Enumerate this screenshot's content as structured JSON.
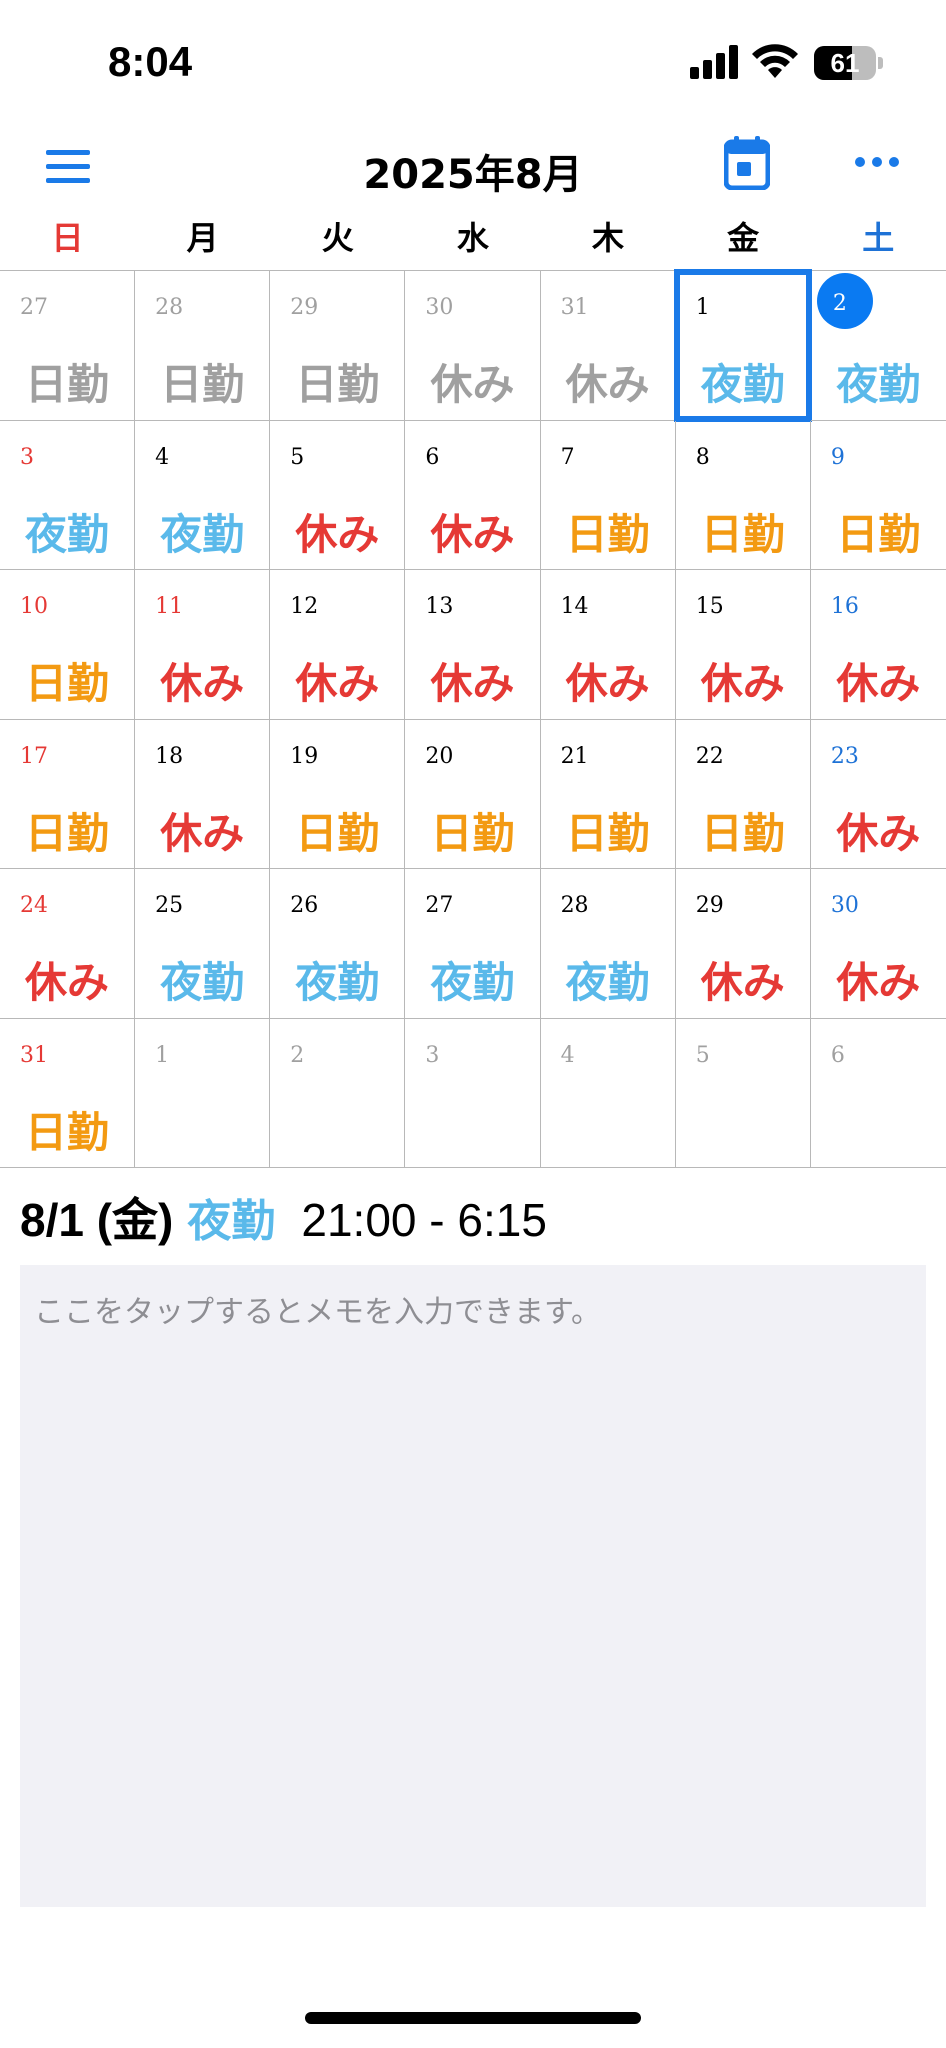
{
  "status_bar": {
    "time": "8:04",
    "battery": "61",
    "battery_level": 0.61
  },
  "header": {
    "title": "2025年8月"
  },
  "weekdays": [
    "日",
    "月",
    "火",
    "水",
    "木",
    "金",
    "土"
  ],
  "colors": {
    "sunday": "#e53935",
    "saturday": "#1e72d6",
    "weekday": "#000000",
    "outside": "#a0a0a0",
    "day_shift": "#f39a12",
    "night_shift": "#5ab9ea",
    "off": "#e53935",
    "accent": "#1a7ae8"
  },
  "calendar": {
    "weeks": [
      [
        {
          "day": "27",
          "shift": "日勤",
          "outside": true
        },
        {
          "day": "28",
          "shift": "日勤",
          "outside": true
        },
        {
          "day": "29",
          "shift": "日勤",
          "outside": true
        },
        {
          "day": "30",
          "shift": "休み",
          "outside": true
        },
        {
          "day": "31",
          "shift": "休み",
          "outside": true
        },
        {
          "day": "1",
          "shift": "夜勤",
          "type": "night",
          "selected": true
        },
        {
          "day": "2",
          "shift": "夜勤",
          "type": "night",
          "today": true
        }
      ],
      [
        {
          "day": "3",
          "shift": "夜勤",
          "type": "night"
        },
        {
          "day": "4",
          "shift": "夜勤",
          "type": "night"
        },
        {
          "day": "5",
          "shift": "休み",
          "type": "off"
        },
        {
          "day": "6",
          "shift": "休み",
          "type": "off"
        },
        {
          "day": "7",
          "shift": "日勤",
          "type": "day"
        },
        {
          "day": "8",
          "shift": "日勤",
          "type": "day"
        },
        {
          "day": "9",
          "shift": "日勤",
          "type": "day"
        }
      ],
      [
        {
          "day": "10",
          "shift": "日勤",
          "type": "day"
        },
        {
          "day": "11",
          "shift": "休み",
          "type": "off",
          "holiday": true
        },
        {
          "day": "12",
          "shift": "休み",
          "type": "off"
        },
        {
          "day": "13",
          "shift": "休み",
          "type": "off"
        },
        {
          "day": "14",
          "shift": "休み",
          "type": "off"
        },
        {
          "day": "15",
          "shift": "休み",
          "type": "off"
        },
        {
          "day": "16",
          "shift": "休み",
          "type": "off"
        }
      ],
      [
        {
          "day": "17",
          "shift": "日勤",
          "type": "day"
        },
        {
          "day": "18",
          "shift": "休み",
          "type": "off"
        },
        {
          "day": "19",
          "shift": "日勤",
          "type": "day"
        },
        {
          "day": "20",
          "shift": "日勤",
          "type": "day"
        },
        {
          "day": "21",
          "shift": "日勤",
          "type": "day"
        },
        {
          "day": "22",
          "shift": "日勤",
          "type": "day"
        },
        {
          "day": "23",
          "shift": "休み",
          "type": "off"
        }
      ],
      [
        {
          "day": "24",
          "shift": "休み",
          "type": "off"
        },
        {
          "day": "25",
          "shift": "夜勤",
          "type": "night"
        },
        {
          "day": "26",
          "shift": "夜勤",
          "type": "night"
        },
        {
          "day": "27",
          "shift": "夜勤",
          "type": "night"
        },
        {
          "day": "28",
          "shift": "夜勤",
          "type": "night"
        },
        {
          "day": "29",
          "shift": "休み",
          "type": "off"
        },
        {
          "day": "30",
          "shift": "休み",
          "type": "off"
        }
      ],
      [
        {
          "day": "31",
          "shift": "日勤",
          "type": "day"
        },
        {
          "day": "1",
          "shift": "",
          "outside": true
        },
        {
          "day": "2",
          "shift": "",
          "outside": true
        },
        {
          "day": "3",
          "shift": "",
          "outside": true
        },
        {
          "day": "4",
          "shift": "",
          "outside": true
        },
        {
          "day": "5",
          "shift": "",
          "outside": true
        },
        {
          "day": "6",
          "shift": "",
          "outside": true
        }
      ]
    ]
  },
  "detail": {
    "date": "8/1 (金)",
    "shift": "夜勤",
    "time": "21:00 - 6:15"
  },
  "memo": {
    "placeholder": "ここをタップするとメモを入力できます。",
    "value": ""
  }
}
